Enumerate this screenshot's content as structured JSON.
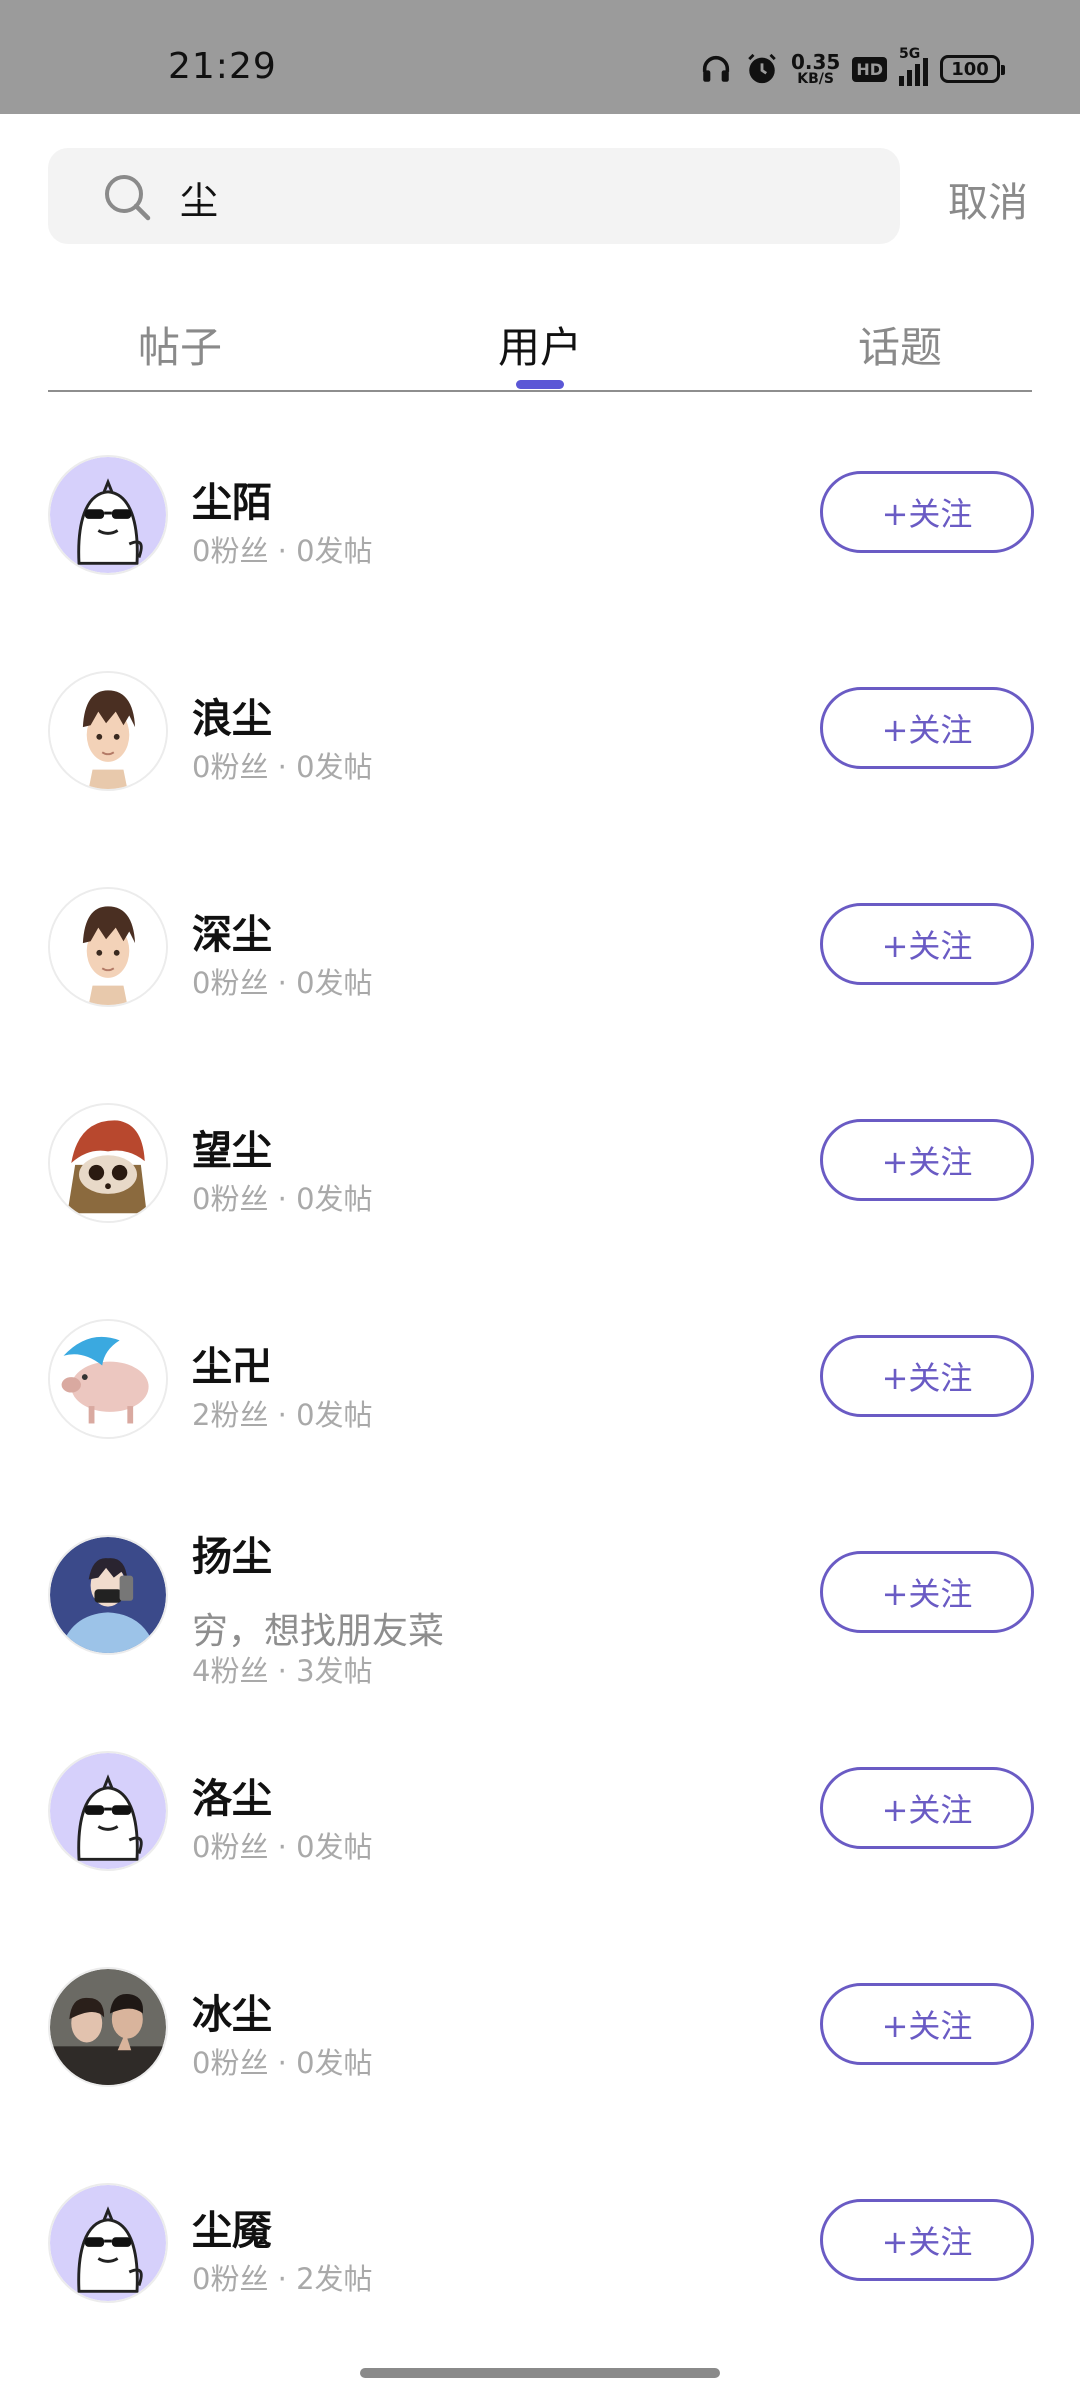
{
  "status_bar": {
    "time": "21:29",
    "net_speed_value": "0.35",
    "net_speed_unit": "KB/S",
    "hd_badge": "HD",
    "network_type": "5G",
    "battery_level": "100",
    "icons": [
      "headphones-icon",
      "alarm-icon",
      "signal-icon",
      "battery-icon"
    ]
  },
  "search": {
    "query": "尘",
    "cancel_label": "取消"
  },
  "tabs": [
    {
      "label": "帖子",
      "active": false
    },
    {
      "label": "用户",
      "active": true
    },
    {
      "label": "话题",
      "active": false
    }
  ],
  "accent_color": "#6a5bc4",
  "users": [
    {
      "name": "尘陌",
      "bio": "",
      "stats": "0粉丝 · 0发帖",
      "follow_label": "+关注",
      "avatar": "default-ghost"
    },
    {
      "name": "浪尘",
      "bio": "",
      "stats": "0粉丝 · 0发帖",
      "follow_label": "+关注",
      "avatar": "cartoon-boy"
    },
    {
      "name": "深尘",
      "bio": "",
      "stats": "0粉丝 · 0发帖",
      "follow_label": "+关注",
      "avatar": "cartoon-boy"
    },
    {
      "name": "望尘",
      "bio": "",
      "stats": "0粉丝 · 0发帖",
      "follow_label": "+关注",
      "avatar": "brown-creature"
    },
    {
      "name": "尘卍",
      "bio": "",
      "stats": "2粉丝 · 0发帖",
      "follow_label": "+关注",
      "avatar": "pink-pig"
    },
    {
      "name": "扬尘",
      "bio": "穷，想找朋友菜",
      "stats": "4粉丝 · 3发帖",
      "follow_label": "+关注",
      "avatar": "anime-boy"
    },
    {
      "name": "洛尘",
      "bio": "",
      "stats": "0粉丝 · 0发帖",
      "follow_label": "+关注",
      "avatar": "default-ghost"
    },
    {
      "name": "冰尘",
      "bio": "",
      "stats": "0粉丝 · 0发帖",
      "follow_label": "+关注",
      "avatar": "photo-people"
    },
    {
      "name": "尘魇",
      "bio": "",
      "stats": "0粉丝 · 2发帖",
      "follow_label": "+关注",
      "avatar": "default-ghost"
    }
  ]
}
